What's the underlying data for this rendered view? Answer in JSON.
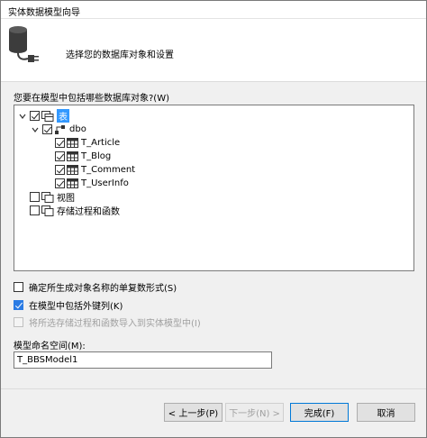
{
  "window": {
    "title": "实体数据模型向导"
  },
  "header": {
    "subtitle": "选择您的数据库对象和设置"
  },
  "objects": {
    "label": "您要在模型中包括哪些数据库对象?(W)",
    "tables_label": "表",
    "schema_label": "dbo",
    "tables": [
      "T_Article",
      "T_Blog",
      "T_Comment",
      "T_UserInfo"
    ],
    "views_label": "视图",
    "procs_label": "存储过程和函数"
  },
  "options": {
    "pluralize": "确定所生成对象名称的单复数形式(S)",
    "foreign_keys": "在模型中包括外键列(K)",
    "import_procs": "将所选存储过程和函数导入到实体模型中(I)"
  },
  "namespace": {
    "label": "模型命名空间(M):",
    "value": "T_BBSModel1"
  },
  "buttons": {
    "prev": "< 上一步(P)",
    "next": "下一步(N) >",
    "finish": "完成(F)",
    "cancel": "取消"
  },
  "colors": {
    "accent": "#2a7be4",
    "selection": "#3399ff"
  }
}
